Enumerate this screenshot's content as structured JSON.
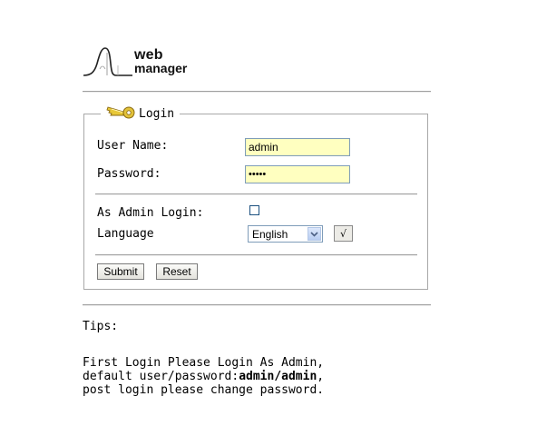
{
  "logo": {
    "word1": "web",
    "word2": "manager"
  },
  "login_panel": {
    "title": "Login",
    "icon": "key-icon",
    "username_label": "User Name:",
    "username_value": "admin",
    "password_label": "Password:",
    "password_value": "•••••",
    "admin_login_label": "As Admin Login:",
    "admin_login_checked": false,
    "language_label": "Language",
    "language_selected": "English",
    "apply_language_label": "√",
    "submit_label": "Submit",
    "reset_label": "Reset"
  },
  "tips": {
    "title": "Tips:",
    "line1": "First Login Please Login As Admin,",
    "line2_prefix": "default user/password:",
    "line2_bold": "admin/admin",
    "line2_suffix": ",",
    "line3": "post login please change password."
  },
  "colors": {
    "input_background": "#ffffc0",
    "key_icon": "#d4b020",
    "border": "#a8a8a8"
  }
}
